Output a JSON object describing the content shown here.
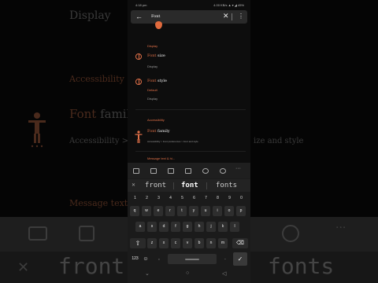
{
  "background": {
    "display": "Display",
    "accessibility": "Accessibility",
    "font_family_prefix": "Font",
    "font_family_rest": " family",
    "path": "Accessibility > Font preferences > Font and style",
    "path_tail": "ize and style",
    "message_text": "Message text",
    "sugg_left": "front",
    "sugg_right": "fonts"
  },
  "status": {
    "time": "4:18 pm",
    "right": "4.00 KB/s ▲ ▾ ◢ 45%"
  },
  "search": {
    "query": "Font"
  },
  "results": {
    "display_header": "Display",
    "font_size_hl": "Font",
    "font_size_rest": " size",
    "font_size_sub": "Display",
    "font_style_hl": "Font",
    "font_style_rest": " style",
    "font_style_value": "Default",
    "font_style_sub": "Display",
    "accessibility_header": "Accessibility",
    "font_family_hl": "Font",
    "font_family_rest": " family",
    "font_family_sub": "Accessibility > Font preferences > Font and style",
    "message_header": "Message text & hi..."
  },
  "keyboard": {
    "suggestions": [
      "front",
      "font",
      "fonts"
    ],
    "numbers": [
      "1",
      "2",
      "3",
      "4",
      "5",
      "6",
      "7",
      "8",
      "9",
      "0"
    ],
    "row1": [
      "q",
      "w",
      "e",
      "r",
      "t",
      "y",
      "u",
      "i",
      "o",
      "p"
    ],
    "row2": [
      "a",
      "s",
      "d",
      "f",
      "g",
      "h",
      "j",
      "k",
      "l"
    ],
    "row3": [
      "z",
      "x",
      "c",
      "v",
      "b",
      "n",
      "m"
    ],
    "sym_label": "123",
    "comma": ",",
    "period": "."
  }
}
